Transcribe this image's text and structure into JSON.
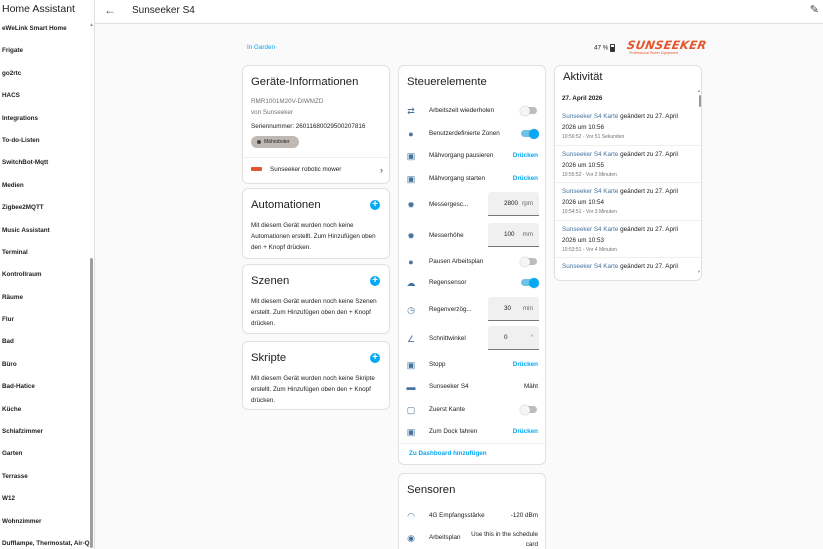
{
  "sidebar": {
    "title": "Home Assistant",
    "items": [
      "eWeLink Smart Home",
      "Frigate",
      "go2rtc",
      "HACS",
      "Integrations",
      "To-do-Listen",
      "SwitchBot-Mqtt",
      "Medien",
      "Zigbee2MQTT",
      "Music Assistant",
      "Terminal",
      "Kontrollraum",
      "Räume",
      "Flur",
      "Bad",
      "Büro",
      "Bad-Hatice",
      "Küche",
      "Schlafzimmer",
      "Garten",
      "Terrasse",
      "W12",
      "Wohnzimmer",
      "Dufflampe, Thermostat, Air-Q"
    ]
  },
  "header": {
    "title": "Sunseeker S4"
  },
  "top": {
    "area": "In Garden",
    "battery": "47 %",
    "logo": "SUNSEEKER",
    "logo_sub": "Professional Power Equipment"
  },
  "device": {
    "title": "Geräte-Informationen",
    "model": "RMR1001M20V-DIWMZD",
    "by": "von Sunseeker",
    "serial": "Seriennummer: 26011680029500207816",
    "chip": "Mähroboter",
    "link": "Sunseeker robotic mower"
  },
  "automations": {
    "title": "Automationen",
    "desc": "Mit diesem Gerät wurden noch keine Automationen erstellt. Zum Hinzufügen oben den + Knopf drücken."
  },
  "scenes": {
    "title": "Szenen",
    "desc": "Mit diesem Gerät wurden noch keine Szenen erstellt. Zum Hinzufügen oben den + Knopf drücken."
  },
  "scripts": {
    "title": "Skripte",
    "desc": "Mit diesem Gerät wurden noch keine Skripte erstellt. Zum Hinzufügen oben den + Knopf drücken."
  },
  "controls": {
    "title": "Steuerelemente",
    "rows": [
      {
        "icon": "repeat-icon",
        "glyph": "⇄",
        "label": "Arbeitszeit wiederholen",
        "type": "toggle",
        "on": false
      },
      {
        "icon": "zones-icon",
        "glyph": "●",
        "label": "Benutzerdefinierte Zonen",
        "type": "toggle",
        "on": true
      },
      {
        "icon": "mower-pause-icon",
        "glyph": "▣",
        "label": "Mähvorgang pausieren",
        "type": "button",
        "action": "Drücken"
      },
      {
        "icon": "mower-start-icon",
        "glyph": "▣",
        "label": "Mähvorgang starten",
        "type": "button",
        "action": "Drücken"
      },
      {
        "icon": "cog-icon",
        "glyph": "✹",
        "label": "Messergesc...",
        "type": "number",
        "value": "2800",
        "unit": "rpm"
      },
      {
        "icon": "cog-icon",
        "glyph": "✹",
        "label": "Messerhöhe",
        "type": "number",
        "value": "100",
        "unit": "mm"
      },
      {
        "icon": "pause-schedule-icon",
        "glyph": "●",
        "label": "Pausen Arbeitsplan",
        "type": "toggle",
        "on": false
      },
      {
        "icon": "rain-icon",
        "glyph": "☁",
        "label": "Regensensor",
        "type": "toggle",
        "on": true
      },
      {
        "icon": "clock-icon",
        "glyph": "◷",
        "label": "Regenverzög...",
        "type": "number",
        "value": "30",
        "unit": "min"
      },
      {
        "icon": "angle-icon",
        "glyph": "∠",
        "label": "Schnittwinkel",
        "type": "number",
        "value": "0",
        "unit": "°"
      },
      {
        "icon": "stop-icon",
        "glyph": "▣",
        "label": "Stopp",
        "type": "button",
        "action": "Drücken"
      },
      {
        "icon": "mower-icon",
        "glyph": "▬",
        "label": "Sunseeker S4",
        "type": "state",
        "value": "Mäht"
      },
      {
        "icon": "border-icon",
        "glyph": "▢",
        "label": "Zuerst Kante",
        "type": "toggle",
        "on": false
      },
      {
        "icon": "dock-icon",
        "glyph": "▣",
        "label": "Zum Dock fahren",
        "type": "button",
        "action": "Drücken"
      }
    ],
    "dashboard": "Zu Dashboard hinzufügen"
  },
  "sensors": {
    "title": "Sensoren",
    "rows": [
      {
        "icon": "wifi-icon",
        "glyph": "◠",
        "label": "4G Empfangsstärke",
        "value": "-120 dBm"
      },
      {
        "icon": "eye-icon",
        "glyph": "◉",
        "label": "Arbeitsplan",
        "value": "Use this in the schedule card"
      }
    ]
  },
  "activity": {
    "title": "Aktivität",
    "date": "27. April 2026",
    "entries": [
      {
        "link": "Sunseeker S4 Karte",
        "text1": " geändert zu 27. April",
        "text2": "2026 um 10:56",
        "meta": "10:56:52 - Vor 51 Sekunden"
      },
      {
        "link": "Sunseeker S4 Karte",
        "text1": " geändert zu 27. April",
        "text2": "2026 um 10:55",
        "meta": "10:55:52 - Vor 2 Minuten"
      },
      {
        "link": "Sunseeker S4 Karte",
        "text1": " geändert zu 27. April",
        "text2": "2026 um 10:54",
        "meta": "10:54:51 - Vor 3 Minuten"
      },
      {
        "link": "Sunseeker S4 Karte",
        "text1": " geändert zu 27. April",
        "text2": "2026 um 10:53",
        "meta": "10:53:51 - Vor 4 Minuten"
      },
      {
        "link": "Sunseeker S4 Karte",
        "text1": " geändert zu 27. April",
        "text2": "",
        "meta": ""
      }
    ]
  }
}
